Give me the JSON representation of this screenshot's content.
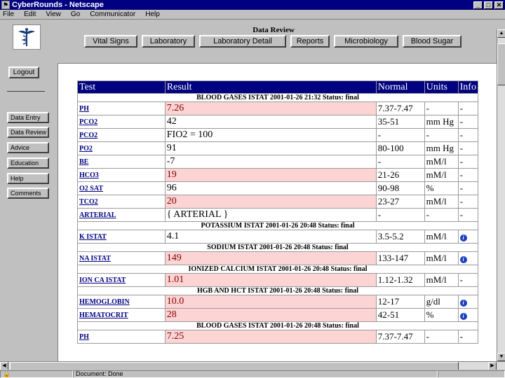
{
  "window": {
    "title": "CyberRounds - Netscape"
  },
  "menu": [
    "File",
    "Edit",
    "View",
    "Go",
    "Communicator",
    "Help"
  ],
  "header": {
    "page_title": "Data Review",
    "nav": [
      "Vital Signs",
      "Laboratory",
      "Laboratory Detail",
      "Reports",
      "Microbiology",
      "Blood Sugar"
    ]
  },
  "sidebar": {
    "logout": "Logout",
    "items": [
      "Data Entry",
      "Data Review",
      "Advice",
      "Education",
      "Help",
      "Comments"
    ]
  },
  "table": {
    "headers": [
      "Test",
      "Result",
      "Normal",
      "Units",
      "Info"
    ],
    "sections": [
      {
        "title": "BLOOD GASES ISTAT 2001-01-26 21:32 Status: final",
        "rows": [
          {
            "test": "PH",
            "result": "7.26",
            "normal": "7.37-7.47",
            "units": "-",
            "info": "-",
            "abnormal": true
          },
          {
            "test": "PCO2",
            "result": "42",
            "normal": "35-51",
            "units": "mm Hg",
            "info": "-",
            "abnormal": false
          },
          {
            "test": "PCO2",
            "result": "FIO2 = 100",
            "normal": "-",
            "units": "-",
            "info": "-",
            "abnormal": false
          },
          {
            "test": "PO2",
            "result": "91",
            "normal": "80-100",
            "units": "mm Hg",
            "info": "-",
            "abnormal": false
          },
          {
            "test": "BE",
            "result": "-7",
            "normal": "-",
            "units": "mM/l",
            "info": "-",
            "abnormal": false
          },
          {
            "test": "HCO3",
            "result": "19",
            "normal": "21-26",
            "units": "mM/l",
            "info": "-",
            "abnormal": true
          },
          {
            "test": "O2 SAT",
            "result": "96",
            "normal": "90-98",
            "units": "%",
            "info": "-",
            "abnormal": false
          },
          {
            "test": "TCO2",
            "result": "20",
            "normal": "23-27",
            "units": "mM/l",
            "info": "-",
            "abnormal": true
          },
          {
            "test": "ARTERIAL",
            "result": "{ ARTERIAL }",
            "normal": "-",
            "units": "-",
            "info": "-",
            "abnormal": false
          }
        ]
      },
      {
        "title": "POTASSIUM ISTAT 2001-01-26 20:48 Status: final",
        "rows": [
          {
            "test": "K ISTAT",
            "result": "4.1",
            "normal": "3.5-5.2",
            "units": "mM/l",
            "info": "i",
            "abnormal": false
          }
        ]
      },
      {
        "title": "SODIUM ISTAT 2001-01-26 20:48 Status: final",
        "rows": [
          {
            "test": "NA ISTAT",
            "result": "149",
            "normal": "133-147",
            "units": "mM/l",
            "info": "i",
            "abnormal": true
          }
        ]
      },
      {
        "title": "IONIZED CALCIUM ISTAT 2001-01-26 20:48 Status: final",
        "rows": [
          {
            "test": "ION CA ISTAT",
            "result": "1.01",
            "normal": "1.12-1.32",
            "units": "mM/l",
            "info": "-",
            "abnormal": true
          }
        ]
      },
      {
        "title": "HGB AND HCT ISTAT 2001-01-26 20:48 Status: final",
        "rows": [
          {
            "test": "HEMOGLOBIN",
            "result": "10.0",
            "normal": "12-17",
            "units": "g/dl",
            "info": "i",
            "abnormal": true
          },
          {
            "test": "HEMATOCRIT",
            "result": "28",
            "normal": "42-51",
            "units": "%",
            "info": "i",
            "abnormal": true
          }
        ]
      },
      {
        "title": "BLOOD GASES ISTAT 2001-01-26 20:48 Status: final",
        "rows": [
          {
            "test": "PH",
            "result": "7.25",
            "normal": "7.37-7.47",
            "units": "-",
            "info": "-",
            "abnormal": true
          }
        ]
      }
    ]
  },
  "status": {
    "text": "Document: Done"
  },
  "colors": {
    "header_bg": "#000080",
    "abnormal_bg": "#fcd4d4",
    "abnormal_text": "#800000",
    "link": "#000080"
  }
}
